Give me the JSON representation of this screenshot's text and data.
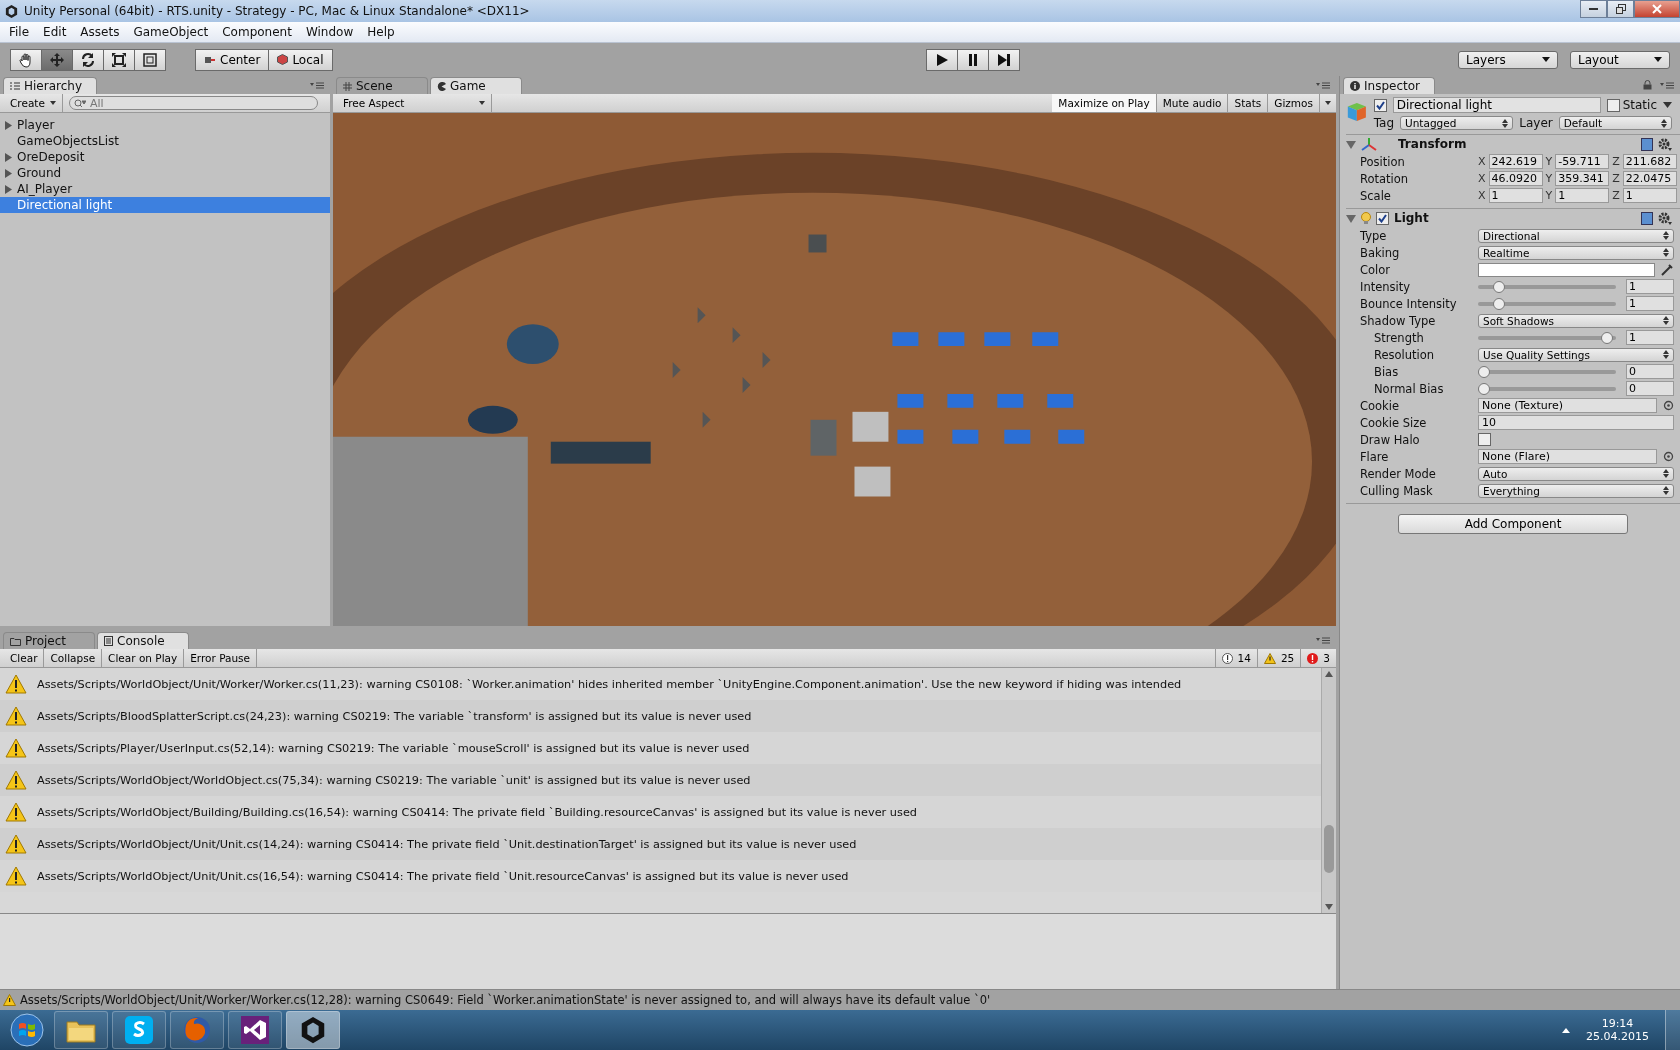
{
  "window": {
    "title": "Unity Personal (64bit) - RTS.unity - Strategy - PC, Mac & Linux Standalone* <DX11>"
  },
  "menu": [
    "File",
    "Edit",
    "Assets",
    "GameObject",
    "Component",
    "Window",
    "Help"
  ],
  "tools": [
    {
      "kind": "hand",
      "selected": false
    },
    {
      "kind": "move",
      "selected": true
    },
    {
      "kind": "rotate",
      "selected": false
    },
    {
      "kind": "scale",
      "selected": false
    },
    {
      "kind": "rect",
      "selected": false
    }
  ],
  "pivot": [
    {
      "kind": "pivot",
      "label": "Center"
    },
    {
      "kind": "space",
      "label": "Local"
    }
  ],
  "playback": [
    {
      "kind": "play"
    },
    {
      "kind": "pause"
    },
    {
      "kind": "step"
    }
  ],
  "top_dropdowns": [
    "Layers",
    "Layout"
  ],
  "hierarchy": {
    "tab": {
      "label": "Hierarchy",
      "selected": true
    },
    "create": "Create",
    "search": {
      "placeholder": "All"
    },
    "items": [
      {
        "label": "Player",
        "expandable": true,
        "selected": false
      },
      {
        "label": "GameObjectsList",
        "expandable": false,
        "selected": false
      },
      {
        "label": "OreDeposit",
        "expandable": true,
        "selected": false
      },
      {
        "label": "Ground",
        "expandable": true,
        "selected": false
      },
      {
        "label": "AI_Player",
        "expandable": true,
        "selected": false
      },
      {
        "label": "Directional light",
        "expandable": false,
        "selected": true
      }
    ]
  },
  "view": {
    "tabs": [
      {
        "label": "Scene",
        "kind": "scene",
        "selected": false
      },
      {
        "label": "Game",
        "kind": "game",
        "selected": true
      }
    ],
    "aspect": "Free Aspect",
    "toggles": [
      {
        "label": "Maximize on Play",
        "on": true
      },
      {
        "label": "Mute audio",
        "on": false
      },
      {
        "label": "Stats",
        "on": false
      },
      {
        "label": "Gizmos",
        "on": false
      }
    ]
  },
  "console": {
    "tabs": [
      {
        "label": "Project",
        "kind": "project",
        "selected": false
      },
      {
        "label": "Console",
        "kind": "console",
        "selected": true
      }
    ],
    "buttons": [
      "Clear",
      "Collapse",
      "Clear on Play",
      "Error Pause"
    ],
    "counts": [
      {
        "kind": "info",
        "count": "14"
      },
      {
        "kind": "warning",
        "count": "25"
      },
      {
        "kind": "error",
        "count": "3"
      }
    ],
    "messages": [
      {
        "kind": "warning",
        "text": "Assets/Scripts/WorldObject/Unit/Worker/Worker.cs(11,23): warning CS0108: `Worker.animation' hides inherited member `UnityEngine.Component.animation'. Use the new keyword if hiding was intended"
      },
      {
        "kind": "warning",
        "text": "Assets/Scripts/BloodSplatterScript.cs(24,23): warning CS0219: The variable `transform' is assigned but its value is never used"
      },
      {
        "kind": "warning",
        "text": "Assets/Scripts/Player/UserInput.cs(52,14): warning CS0219: The variable `mouseScroll' is assigned but its value is never used"
      },
      {
        "kind": "warning",
        "text": "Assets/Scripts/WorldObject/WorldObject.cs(75,34): warning CS0219: The variable `unit' is assigned but its value is never used"
      },
      {
        "kind": "warning",
        "text": "Assets/Scripts/WorldObject/Building/Building.cs(16,54): warning CS0414: The private field `Building.resourceCanvas' is assigned but its value is never used"
      },
      {
        "kind": "warning",
        "text": "Assets/Scripts/WorldObject/Unit/Unit.cs(14,24): warning CS0414: The private field `Unit.destinationTarget' is assigned but its value is never used"
      },
      {
        "kind": "warning",
        "text": "Assets/Scripts/WorldObject/Unit/Unit.cs(16,54): warning CS0414: The private field `Unit.resourceCanvas' is assigned but its value is never used"
      }
    ]
  },
  "inspector": {
    "tab": {
      "label": "Inspector",
      "selected": true
    },
    "object": {
      "active": true,
      "name": "Directional light",
      "static": {
        "label": "Static",
        "checked": false
      },
      "tag_label": "Tag",
      "tag": "Untagged",
      "layer_label": "Layer",
      "layer": "Default"
    },
    "transform": {
      "title": "Transform",
      "expanded": true,
      "rows": [
        {
          "label": "Position",
          "axes": [
            {
              "axis": "X",
              "value": "242.619"
            },
            {
              "axis": "Y",
              "value": "-59.711"
            },
            {
              "axis": "Z",
              "value": "211.682"
            }
          ]
        },
        {
          "label": "Rotation",
          "axes": [
            {
              "axis": "X",
              "value": "46.0920"
            },
            {
              "axis": "Y",
              "value": "359.341"
            },
            {
              "axis": "Z",
              "value": "22.0475"
            }
          ]
        },
        {
          "label": "Scale",
          "axes": [
            {
              "axis": "X",
              "value": "1"
            },
            {
              "axis": "Y",
              "value": "1"
            },
            {
              "axis": "Z",
              "value": "1"
            }
          ]
        }
      ]
    },
    "light": {
      "title": "Light",
      "expanded": true,
      "enabled": true,
      "rows": [
        {
          "kind": "dropdown",
          "label": "Type",
          "value": "Directional"
        },
        {
          "kind": "dropdown",
          "label": "Baking",
          "value": "Realtime"
        },
        {
          "kind": "color",
          "label": "Color",
          "color": "#ffffff"
        },
        {
          "kind": "slider",
          "label": "Intensity",
          "level": 0.12,
          "value": "1"
        },
        {
          "kind": "slider",
          "label": "Bounce Intensity",
          "level": 0.12,
          "value": "1"
        },
        {
          "kind": "dropdown",
          "label": "Shadow Type",
          "value": "Soft Shadows",
          "children": [
            {
              "kind": "slider",
              "label": "Strength",
              "level": 0.98,
              "value": "1"
            },
            {
              "kind": "dropdown",
              "label": "Resolution",
              "value": "Use Quality Settings"
            },
            {
              "kind": "slider",
              "label": "Bias",
              "level": 0,
              "value": "0"
            },
            {
              "kind": "slider",
              "label": "Normal Bias",
              "level": 0,
              "value": "0"
            }
          ]
        },
        {
          "kind": "object",
          "label": "Cookie",
          "value": "None (Texture)"
        },
        {
          "kind": "field",
          "label": "Cookie Size",
          "value": "10"
        },
        {
          "kind": "checkbox",
          "label": "Draw Halo",
          "checked": false
        },
        {
          "kind": "object",
          "label": "Flare",
          "value": "None (Flare)"
        },
        {
          "kind": "dropdown",
          "label": "Render Mode",
          "value": "Auto"
        },
        {
          "kind": "dropdown",
          "label": "Culling Mask",
          "value": "Everything"
        }
      ]
    },
    "add_component": "Add Component"
  },
  "status_bar": {
    "kind": "warning",
    "text": "Assets/Scripts/WorldObject/Unit/Worker/Worker.cs(12,28): warning CS0649: Field `Worker.animationState' is never assigned to, and will always have its default value `0'"
  },
  "taskbar": {
    "apps": [
      {
        "kind": "explorer",
        "selected": false
      },
      {
        "kind": "skype",
        "selected": false
      },
      {
        "kind": "firefox",
        "selected": false
      },
      {
        "kind": "visualstudio",
        "selected": false
      },
      {
        "kind": "unity",
        "selected": true
      }
    ],
    "time": "19:14",
    "date": "25.04.2015"
  }
}
